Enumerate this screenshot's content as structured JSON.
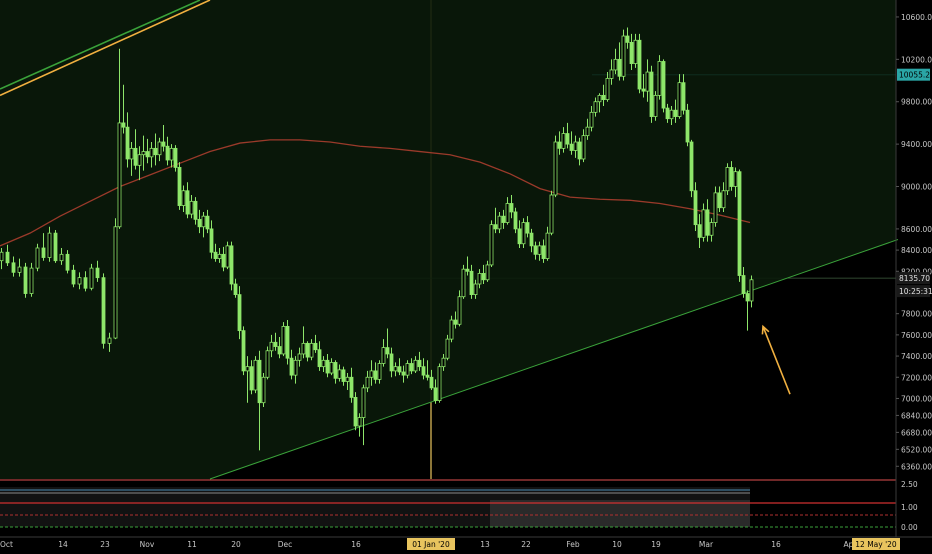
{
  "chart_data": {
    "type": "candlestick",
    "ylim": [
      6240,
      10760
    ],
    "y_ticks": [
      10600,
      10200,
      9800,
      9400,
      9000,
      8600,
      8400,
      8200,
      7800,
      7600,
      7400,
      7200,
      7000,
      6840,
      6680,
      6520,
      6360
    ],
    "y_tick_labels": [
      "10600.00",
      "10200.00",
      "9800.00",
      "9400.00",
      "9000.00",
      "8600.00",
      "8400.00",
      "8200.00",
      "7800.00",
      "7600.00",
      "7400.00",
      "7200.00",
      "7000.00",
      "6840.00",
      "6680.00",
      "6520.00",
      "6360.00"
    ],
    "x_labels": [
      "Oct",
      "14",
      "23",
      "Nov",
      "11",
      "20",
      "Dec",
      "16",
      "01 Jan '20",
      "13",
      "22",
      "Feb",
      "10",
      "19",
      "Mar",
      "16",
      "Apr",
      "12 May '20"
    ],
    "highlighted_x_labels": [
      "01 Jan '20",
      "12 May '20"
    ],
    "price_badges": {
      "resistance": "10055.20",
      "last_price": "8135.70",
      "countdown": "10:25:31"
    },
    "resistance_level": 10055.2,
    "last_price": 8135.7,
    "ma_line": [
      [
        0,
        8440
      ],
      [
        30,
        8560
      ],
      [
        60,
        8720
      ],
      [
        90,
        8860
      ],
      [
        120,
        9000
      ],
      [
        150,
        9110
      ],
      [
        180,
        9220
      ],
      [
        210,
        9330
      ],
      [
        240,
        9410
      ],
      [
        270,
        9440
      ],
      [
        300,
        9440
      ],
      [
        330,
        9420
      ],
      [
        360,
        9380
      ],
      [
        390,
        9360
      ],
      [
        420,
        9330
      ],
      [
        450,
        9300
      ],
      [
        480,
        9230
      ],
      [
        510,
        9120
      ],
      [
        540,
        8980
      ],
      [
        570,
        8900
      ],
      [
        600,
        8880
      ],
      [
        630,
        8870
      ],
      [
        660,
        8840
      ],
      [
        690,
        8790
      ],
      [
        720,
        8730
      ],
      [
        750,
        8660
      ]
    ],
    "trendline": {
      "from": [
        210,
        6240
      ],
      "to": [
        898,
        8500
      ]
    },
    "upper_channel": [
      {
        "from": [
          0,
          9860
        ],
        "to": [
          210,
          10760
        ],
        "color": "#f0b040"
      },
      {
        "from": [
          0,
          9920
        ],
        "to": [
          200,
          10760
        ],
        "color": "#3aa23a"
      }
    ],
    "vertical_marker": {
      "x": 431,
      "color": "#e8c45e"
    },
    "arrow": {
      "from": [
        790,
        7040
      ],
      "to": [
        763,
        7680
      ],
      "color": "#f0b040"
    },
    "candles": [
      [
        0,
        8300,
        8420,
        8220,
        8380
      ],
      [
        6,
        8380,
        8450,
        8250,
        8280
      ],
      [
        12,
        8280,
        8340,
        8150,
        8190
      ],
      [
        18,
        8190,
        8320,
        8150,
        8240
      ],
      [
        24,
        8240,
        8280,
        7950,
        7990
      ],
      [
        30,
        7990,
        8280,
        7960,
        8230
      ],
      [
        36,
        8230,
        8460,
        8200,
        8420
      ],
      [
        42,
        8420,
        8560,
        8300,
        8330
      ],
      [
        48,
        8330,
        8620,
        8290,
        8560
      ],
      [
        54,
        8560,
        8590,
        8280,
        8300
      ],
      [
        60,
        8300,
        8420,
        8260,
        8360
      ],
      [
        66,
        8360,
        8400,
        8180,
        8210
      ],
      [
        72,
        8210,
        8260,
        8050,
        8080
      ],
      [
        78,
        8080,
        8190,
        8030,
        8140
      ],
      [
        84,
        8140,
        8200,
        8010,
        8040
      ],
      [
        90,
        8040,
        8270,
        8020,
        8230
      ],
      [
        96,
        8230,
        8300,
        8100,
        8140
      ],
      [
        102,
        8140,
        8180,
        7470,
        7520
      ],
      [
        108,
        7520,
        7620,
        7440,
        7570
      ],
      [
        114,
        7570,
        8700,
        7560,
        8620
      ],
      [
        118,
        8620,
        10300,
        8600,
        9600
      ],
      [
        122,
        9600,
        9960,
        9500,
        9560
      ],
      [
        126,
        9560,
        9700,
        9180,
        9260
      ],
      [
        130,
        9260,
        9420,
        9100,
        9360
      ],
      [
        134,
        9360,
        9540,
        9160,
        9200
      ],
      [
        138,
        9200,
        9380,
        9060,
        9300
      ],
      [
        142,
        9300,
        9480,
        9150,
        9330
      ],
      [
        146,
        9330,
        9450,
        9220,
        9280
      ],
      [
        150,
        9280,
        9420,
        9180,
        9360
      ],
      [
        154,
        9360,
        9500,
        9200,
        9300
      ],
      [
        158,
        9300,
        9460,
        9240,
        9420
      ],
      [
        162,
        9420,
        9580,
        9330,
        9380
      ],
      [
        166,
        9380,
        9470,
        9200,
        9250
      ],
      [
        170,
        9250,
        9400,
        9180,
        9360
      ],
      [
        174,
        9360,
        9390,
        9140,
        9180
      ],
      [
        178,
        9180,
        9230,
        8780,
        8820
      ],
      [
        182,
        8820,
        9010,
        8760,
        8960
      ],
      [
        186,
        8960,
        9040,
        8700,
        8740
      ],
      [
        190,
        8740,
        8920,
        8700,
        8860
      ],
      [
        194,
        8860,
        8900,
        8640,
        8690
      ],
      [
        198,
        8690,
        8780,
        8560,
        8620
      ],
      [
        202,
        8620,
        8760,
        8520,
        8720
      ],
      [
        206,
        8720,
        8780,
        8560,
        8600
      ],
      [
        210,
        8600,
        8680,
        8320,
        8380
      ],
      [
        214,
        8380,
        8460,
        8290,
        8320
      ],
      [
        218,
        8320,
        8420,
        8280,
        8360
      ],
      [
        222,
        8360,
        8430,
        8200,
        8240
      ],
      [
        226,
        8240,
        8480,
        8220,
        8440
      ],
      [
        230,
        8440,
        8480,
        8020,
        8080
      ],
      [
        234,
        8080,
        8130,
        7950,
        7980
      ],
      [
        238,
        7980,
        8060,
        7560,
        7640
      ],
      [
        242,
        7640,
        7680,
        7220,
        7260
      ],
      [
        246,
        7260,
        7400,
        6960,
        7300
      ],
      [
        250,
        7300,
        7360,
        7040,
        7080
      ],
      [
        254,
        7080,
        7400,
        7050,
        7360
      ],
      [
        258,
        7360,
        7450,
        6510,
        6960
      ],
      [
        262,
        6960,
        7240,
        6920,
        7200
      ],
      [
        266,
        7200,
        7490,
        7180,
        7450
      ],
      [
        270,
        7450,
        7600,
        7390,
        7530
      ],
      [
        274,
        7530,
        7620,
        7450,
        7490
      ],
      [
        278,
        7490,
        7580,
        7380,
        7420
      ],
      [
        282,
        7420,
        7720,
        7400,
        7680
      ],
      [
        286,
        7680,
        7740,
        7320,
        7380
      ],
      [
        290,
        7380,
        7460,
        7180,
        7220
      ],
      [
        294,
        7220,
        7400,
        7140,
        7360
      ],
      [
        298,
        7360,
        7480,
        7300,
        7420
      ],
      [
        302,
        7420,
        7680,
        7380,
        7520
      ],
      [
        306,
        7520,
        7540,
        7350,
        7390
      ],
      [
        310,
        7390,
        7560,
        7360,
        7520
      ],
      [
        314,
        7520,
        7600,
        7430,
        7460
      ],
      [
        318,
        7460,
        7540,
        7260,
        7300
      ],
      [
        322,
        7300,
        7400,
        7250,
        7360
      ],
      [
        326,
        7360,
        7420,
        7200,
        7240
      ],
      [
        330,
        7240,
        7380,
        7220,
        7340
      ],
      [
        334,
        7340,
        7360,
        7140,
        7190
      ],
      [
        338,
        7190,
        7320,
        7160,
        7270
      ],
      [
        342,
        7270,
        7300,
        7120,
        7160
      ],
      [
        346,
        7160,
        7240,
        7080,
        7200
      ],
      [
        350,
        7200,
        7290,
        6960,
        7010
      ],
      [
        354,
        7010,
        7060,
        6700,
        6740
      ],
      [
        358,
        6740,
        6860,
        6640,
        6820
      ],
      [
        362,
        6820,
        7130,
        6560,
        7100
      ],
      [
        366,
        7100,
        7260,
        7060,
        7200
      ],
      [
        370,
        7200,
        7360,
        7120,
        7260
      ],
      [
        374,
        7260,
        7340,
        7140,
        7180
      ],
      [
        378,
        7180,
        7360,
        7140,
        7330
      ],
      [
        382,
        7330,
        7560,
        7300,
        7480
      ],
      [
        386,
        7480,
        7660,
        7380,
        7420
      ],
      [
        390,
        7420,
        7480,
        7200,
        7260
      ],
      [
        394,
        7260,
        7340,
        7210,
        7300
      ],
      [
        398,
        7300,
        7380,
        7220,
        7250
      ],
      [
        402,
        7250,
        7310,
        7150,
        7220
      ],
      [
        406,
        7220,
        7360,
        7190,
        7330
      ],
      [
        410,
        7330,
        7380,
        7230,
        7260
      ],
      [
        414,
        7260,
        7400,
        7240,
        7360
      ],
      [
        418,
        7360,
        7440,
        7260,
        7300
      ],
      [
        422,
        7300,
        7380,
        7180,
        7220
      ],
      [
        426,
        7220,
        7360,
        7170,
        7200
      ],
      [
        430,
        7200,
        7270,
        7080,
        7100
      ],
      [
        434,
        7100,
        7180,
        6950,
        6980
      ],
      [
        438,
        6980,
        7330,
        6960,
        7300
      ],
      [
        442,
        7300,
        7420,
        7260,
        7380
      ],
      [
        446,
        7380,
        7600,
        7360,
        7560
      ],
      [
        450,
        7560,
        7780,
        7530,
        7740
      ],
      [
        454,
        7740,
        7820,
        7660,
        7700
      ],
      [
        458,
        7700,
        8020,
        7680,
        7960
      ],
      [
        462,
        7960,
        8260,
        7940,
        8220
      ],
      [
        466,
        8220,
        8340,
        8160,
        8200
      ],
      [
        470,
        8200,
        8260,
        7940,
        7980
      ],
      [
        474,
        7980,
        8120,
        7940,
        8080
      ],
      [
        478,
        8080,
        8220,
        8040,
        8180
      ],
      [
        482,
        8180,
        8260,
        8080,
        8120
      ],
      [
        486,
        8120,
        8300,
        8100,
        8260
      ],
      [
        490,
        8260,
        8680,
        8240,
        8640
      ],
      [
        494,
        8640,
        8800,
        8560,
        8600
      ],
      [
        498,
        8600,
        8760,
        8560,
        8720
      ],
      [
        502,
        8720,
        8780,
        8600,
        8660
      ],
      [
        506,
        8660,
        8900,
        8640,
        8840
      ],
      [
        510,
        8840,
        8920,
        8700,
        8760
      ],
      [
        514,
        8760,
        8800,
        8560,
        8600
      ],
      [
        518,
        8600,
        8680,
        8420,
        8460
      ],
      [
        522,
        8460,
        8700,
        8420,
        8660
      ],
      [
        526,
        8660,
        8720,
        8520,
        8560
      ],
      [
        530,
        8560,
        8600,
        8380,
        8440
      ],
      [
        534,
        8440,
        8480,
        8310,
        8360
      ],
      [
        538,
        8360,
        8480,
        8300,
        8440
      ],
      [
        542,
        8440,
        8500,
        8280,
        8320
      ],
      [
        546,
        8320,
        8620,
        8300,
        8560
      ],
      [
        550,
        8560,
        8960,
        8540,
        8920
      ],
      [
        554,
        8920,
        9480,
        8900,
        9420
      ],
      [
        558,
        9420,
        9520,
        9300,
        9360
      ],
      [
        562,
        9360,
        9560,
        9320,
        9500
      ],
      [
        566,
        9500,
        9600,
        9360,
        9400
      ],
      [
        570,
        9400,
        9520,
        9300,
        9340
      ],
      [
        574,
        9340,
        9480,
        9270,
        9420
      ],
      [
        578,
        9420,
        9460,
        9200,
        9260
      ],
      [
        582,
        9260,
        9540,
        9230,
        9480
      ],
      [
        586,
        9480,
        9640,
        9440,
        9560
      ],
      [
        590,
        9560,
        9760,
        9520,
        9700
      ],
      [
        594,
        9700,
        9840,
        9660,
        9800
      ],
      [
        598,
        9800,
        9880,
        9700,
        9860
      ],
      [
        602,
        9860,
        9960,
        9760,
        9820
      ],
      [
        606,
        9820,
        10080,
        9800,
        10020
      ],
      [
        610,
        10020,
        10200,
        9960,
        10100
      ],
      [
        614,
        10100,
        10300,
        10060,
        10200
      ],
      [
        618,
        10200,
        10360,
        10000,
        10040
      ],
      [
        622,
        10040,
        10480,
        10000,
        10420
      ],
      [
        626,
        10420,
        10500,
        10300,
        10360
      ],
      [
        630,
        10360,
        10440,
        10100,
        10160
      ],
      [
        634,
        10160,
        10440,
        10120,
        10380
      ],
      [
        638,
        10380,
        10440,
        9880,
        9920
      ],
      [
        642,
        9920,
        10060,
        9840,
        9900
      ],
      [
        646,
        9900,
        10200,
        9800,
        10080
      ],
      [
        650,
        10080,
        10140,
        9600,
        9660
      ],
      [
        654,
        9660,
        9900,
        9620,
        9860
      ],
      [
        658,
        9860,
        10240,
        9820,
        10180
      ],
      [
        662,
        10180,
        10200,
        9700,
        9740
      ],
      [
        666,
        9740,
        9780,
        9600,
        9640
      ],
      [
        670,
        9640,
        9760,
        9580,
        9720
      ],
      [
        674,
        9720,
        9820,
        9600,
        9660
      ],
      [
        678,
        9660,
        10060,
        9640,
        9980
      ],
      [
        682,
        9980,
        10060,
        9680,
        9720
      ],
      [
        686,
        9720,
        9780,
        9380,
        9420
      ],
      [
        690,
        9420,
        9440,
        8900,
        8960
      ],
      [
        694,
        8960,
        9040,
        8580,
        8640
      ],
      [
        698,
        8640,
        8740,
        8420,
        8520
      ],
      [
        702,
        8520,
        8840,
        8480,
        8780
      ],
      [
        706,
        8780,
        8880,
        8480,
        8540
      ],
      [
        710,
        8540,
        8700,
        8480,
        8660
      ],
      [
        714,
        8660,
        9000,
        8620,
        8940
      ],
      [
        718,
        8940,
        9000,
        8760,
        8800
      ],
      [
        722,
        8800,
        9040,
        8760,
        8960
      ],
      [
        726,
        8960,
        9220,
        8920,
        9180
      ],
      [
        730,
        9180,
        9240,
        8960,
        9000
      ],
      [
        734,
        9000,
        9180,
        8900,
        9140
      ],
      [
        738,
        9140,
        9160,
        8100,
        8160
      ],
      [
        742,
        8160,
        8240,
        7950,
        7990
      ],
      [
        746,
        7990,
        8020,
        7640,
        7920
      ],
      [
        750,
        7920,
        8160,
        7860,
        8120
      ]
    ]
  },
  "oscillator": {
    "levels": [
      "2.50",
      "1.00",
      "0.00"
    ],
    "level_colors": [
      "#e05050",
      "#d03030",
      "#3aa23a"
    ]
  },
  "colors": {
    "background": "#000000",
    "candle": "#8ee66a",
    "grid": "#2a2a2a",
    "ma": "#9a3a2a",
    "trendline": "#3aa23a",
    "resistance_line": "#2aa6a6"
  }
}
